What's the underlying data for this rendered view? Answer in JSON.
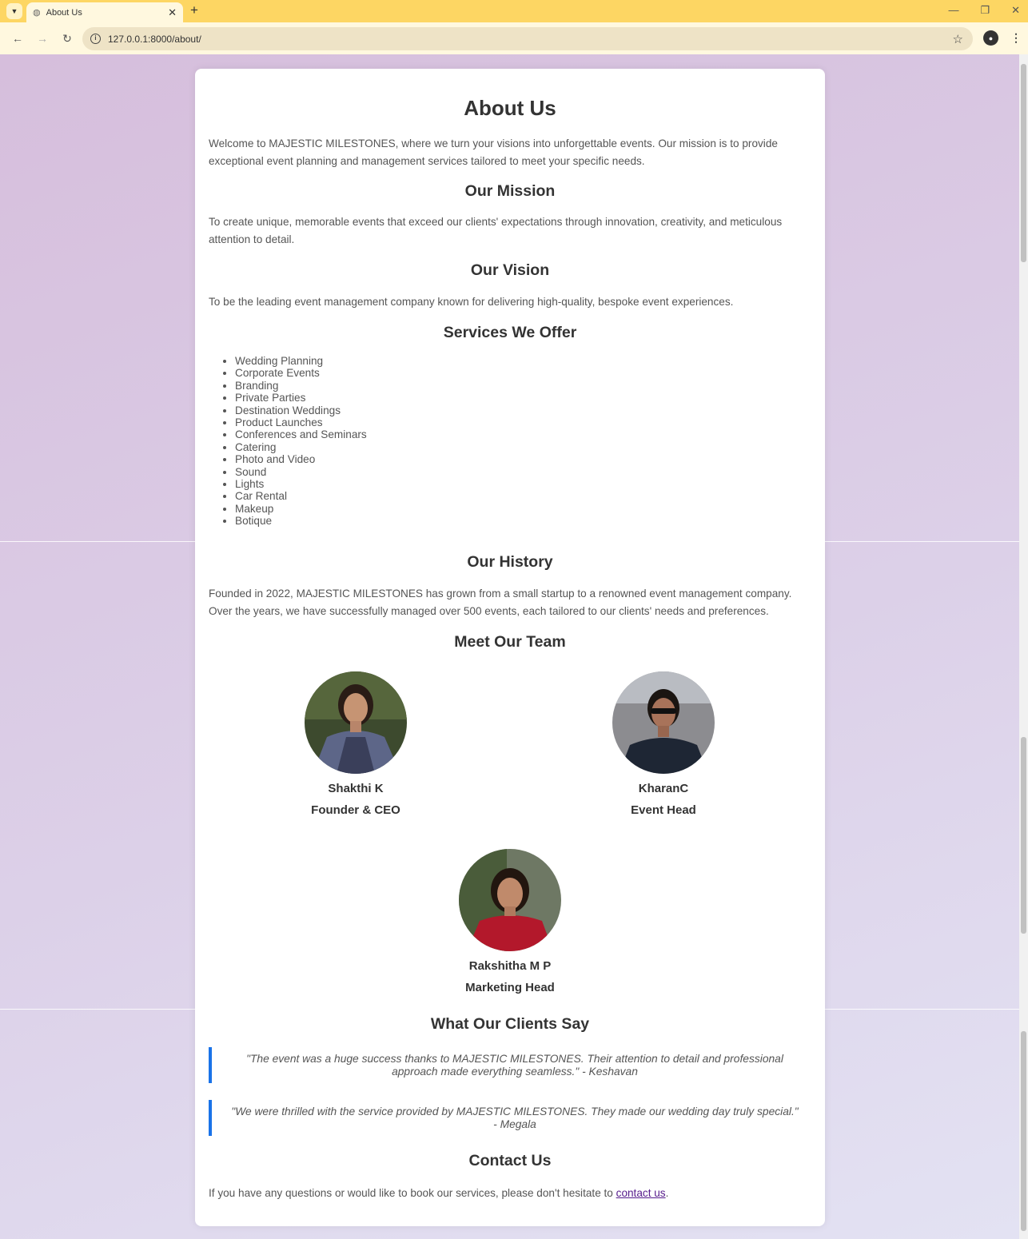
{
  "browser": {
    "tab_title": "About Us",
    "url": "127.0.0.1:8000/about/"
  },
  "page": {
    "title": "About Us",
    "intro": "Welcome to MAJESTIC MILESTONES, where we turn your visions into unforgettable events. Our mission is to provide exceptional event planning and management services tailored to meet your specific needs.",
    "mission": {
      "heading": "Our Mission",
      "text": "To create unique, memorable events that exceed our clients' expectations through innovation, creativity, and meticulous attention to detail."
    },
    "vision": {
      "heading": "Our Vision",
      "text": "To be the leading event management company known for delivering high-quality, bespoke event experiences."
    },
    "services": {
      "heading": "Services We Offer",
      "items": [
        "Wedding Planning",
        "Corporate Events",
        "Branding",
        "Private Parties",
        "Destination Weddings",
        "Product Launches",
        "Conferences and Seminars",
        "Catering",
        "Photo and Video",
        "Sound",
        "Lights",
        "Car Rental",
        "Makeup",
        "Botique"
      ]
    },
    "history": {
      "heading": "Our History",
      "text": "Founded in 2022, MAJESTIC MILESTONES has grown from a small startup to a renowned event management company. Over the years, we have successfully managed over 500 events, each tailored to our clients' needs and preferences."
    },
    "team": {
      "heading": "Meet Our Team",
      "members": [
        {
          "name": "Shakthi K",
          "role": "Founder & CEO"
        },
        {
          "name": "KharanC",
          "role": "Event Head"
        },
        {
          "name": "Rakshitha M P",
          "role": "Marketing Head"
        }
      ]
    },
    "testimonials": {
      "heading": "What Our Clients Say",
      "quotes": [
        "\"The event was a huge success thanks to MAJESTIC MILESTONES. Their attention to detail and professional approach made everything seamless.\" - Keshavan",
        "\"We were thrilled with the service provided by MAJESTIC MILESTONES. They made our wedding day truly special.\" - Megala"
      ]
    },
    "contact": {
      "heading": "Contact Us",
      "text_before": "If you have any questions or would like to book our services, please don't hesitate to ",
      "link_text": "contact us",
      "text_after": "."
    }
  },
  "colors": {
    "quote_border": "#1a73e8",
    "tab_bar": "#fdd663",
    "link": "#551a8b"
  }
}
